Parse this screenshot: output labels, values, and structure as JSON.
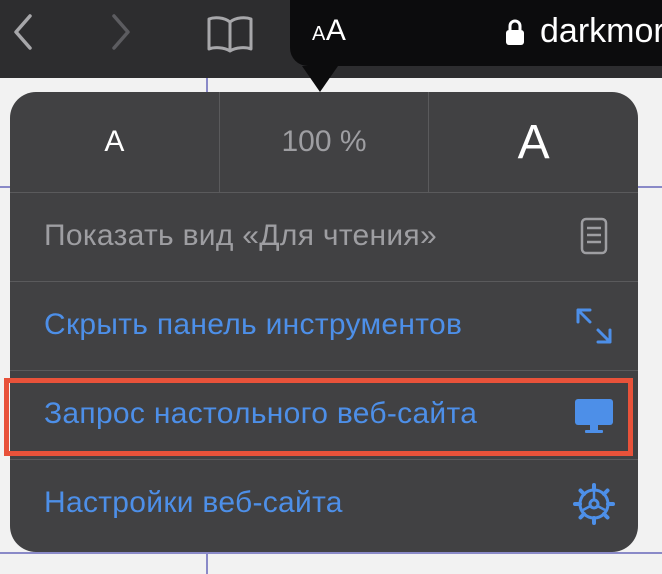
{
  "toolbar": {
    "back_icon": "chevron-left-icon",
    "forward_icon": "chevron-right-icon",
    "reader_icon": "book-icon",
    "aa_small": "A",
    "aa_large": "A",
    "lock_icon": "lock-icon",
    "domain": "darkmor"
  },
  "zoom": {
    "decrease_label": "A",
    "percent": "100 %",
    "increase_label": "A"
  },
  "menu": {
    "items": [
      {
        "label": "Показать вид «Для чтения»",
        "icon": "reader-page-icon",
        "enabled": false
      },
      {
        "label": "Скрыть панель инструментов",
        "icon": "expand-arrows-icon",
        "enabled": true
      },
      {
        "label": "Запрос настольного веб-сайта",
        "icon": "desktop-monitor-icon",
        "enabled": true
      },
      {
        "label": "Настройки веб-сайта",
        "icon": "gear-icon",
        "enabled": true
      }
    ]
  },
  "colors": {
    "accent": "#4d8fe8",
    "highlight": "#e8523a",
    "popover_bg": "#414143",
    "disabled_text": "#9e9ea2"
  }
}
